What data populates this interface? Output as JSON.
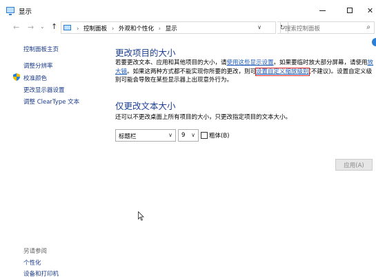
{
  "window": {
    "title": "显示",
    "minimize": "—",
    "maximize": "☐",
    "close": "✕"
  },
  "nav": {
    "back": "←",
    "forward": "→",
    "recent": "⌄",
    "up": "↑",
    "breadcrumbs": [
      "控制面板",
      "外观和个性化",
      "显示"
    ],
    "separator": "›",
    "dropdown": "∨",
    "refresh": "↻",
    "search_placeholder": "搜索控制面板",
    "search_icon": "⌕"
  },
  "sidebar": {
    "items": [
      {
        "label": "控制面板主页"
      },
      {
        "label": "调整分辨率"
      },
      {
        "label": "校准颜色",
        "icon": "shield-icon"
      },
      {
        "label": "更改显示器设置"
      },
      {
        "label": "调整 ClearType 文本"
      }
    ],
    "see_also_title": "另请参阅",
    "see_also": [
      {
        "label": "个性化"
      },
      {
        "label": "设备和打印机"
      }
    ]
  },
  "main": {
    "section1_title": "更改项目的大小",
    "para": {
      "t1": "若要更改文本、应用和其他项目的大小，请",
      "link1": "使用这些显示设置",
      "t2": "。如果要临时放大部分屏幕，请使用",
      "link2": "放大镜",
      "t3": "。如果这两种方式都不能实现你所要的更改，则可",
      "link3": "设置自定义缩放级别",
      "t4": "(不建议)。设置自定义级别可能会导致在某些显示器上出现意外行为。"
    },
    "section2_title": "仅更改文本大小",
    "section2_desc": "还可以不更改桌面上所有项目的大小，只更改指定项目的文本大小。",
    "item_select": "标题栏",
    "size_select": "9",
    "bold_label": "粗体(B)",
    "bold_checked": false,
    "apply_label": "应用(A)",
    "apply_enabled": false,
    "select_arrow": "∨"
  },
  "colors": {
    "heading": "#1c3f94",
    "link": "#1c5bb8",
    "highlight_box": "#e02020"
  }
}
